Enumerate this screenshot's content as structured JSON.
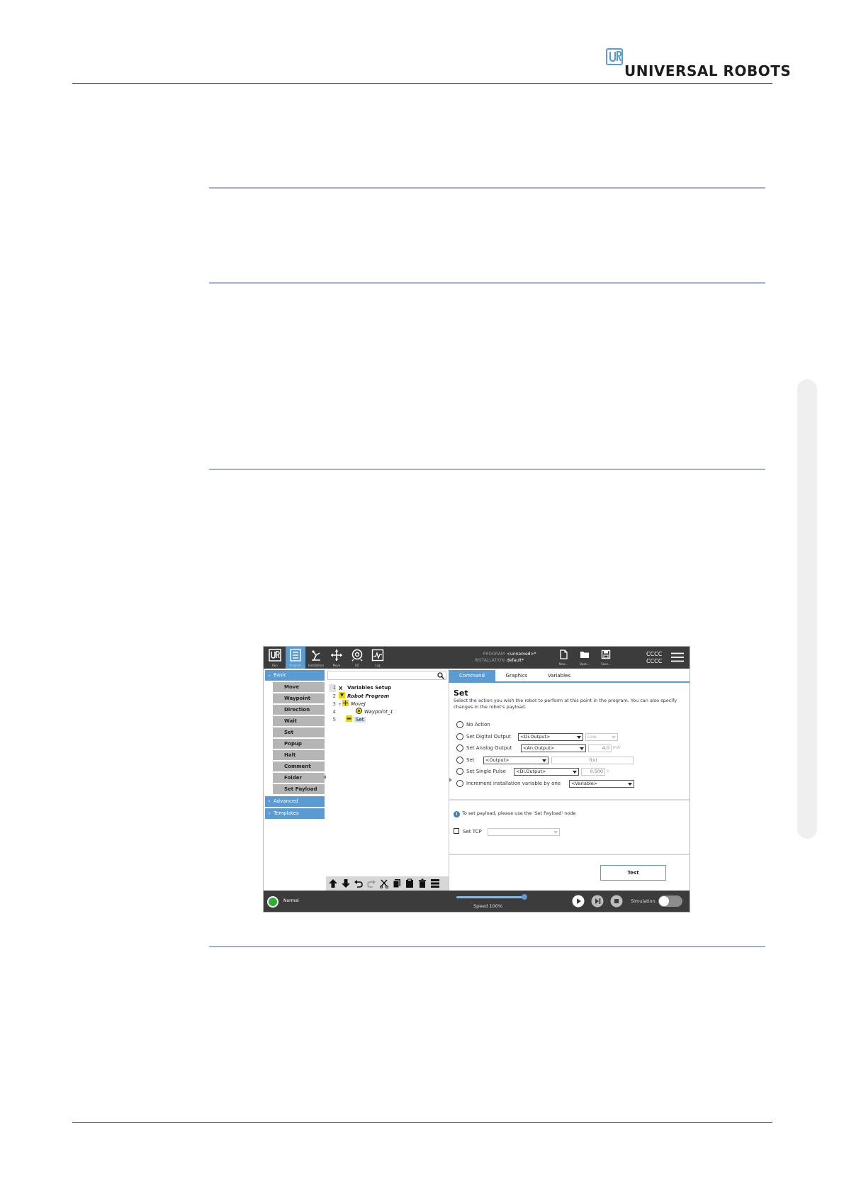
{
  "header": {
    "logo_text": "UNIVERSAL ROBOTS"
  },
  "screenshot": {
    "toolbar": {
      "buttons": [
        {
          "label": "Run",
          "icon": "ur-logo-icon"
        },
        {
          "label": "Program",
          "icon": "program-icon",
          "active": true
        },
        {
          "label": "Installation",
          "icon": "installation-icon"
        },
        {
          "label": "Move",
          "icon": "move-icon"
        },
        {
          "label": "I/O",
          "icon": "io-icon"
        },
        {
          "label": "Log",
          "icon": "log-icon"
        }
      ],
      "program_label": "PROGRAM",
      "program_value": "<unnamed>*",
      "installation_label": "INSTALLATION",
      "installation_value": "default*",
      "file_buttons": [
        {
          "label": "New...",
          "icon": "new-file-icon"
        },
        {
          "label": "Open...",
          "icon": "open-folder-icon"
        },
        {
          "label": "Save...",
          "icon": "save-icon"
        }
      ],
      "status_code_1": "CCCC",
      "status_code_2": "CCCC"
    },
    "palette": {
      "basic_label": "Basic",
      "basic_items": [
        "Move",
        "Waypoint",
        "Direction",
        "Wait",
        "Set",
        "Popup",
        "Halt",
        "Comment",
        "Folder",
        "Set Payload"
      ],
      "advanced_label": "Advanced",
      "templates_label": "Templates"
    },
    "tree": {
      "rows": [
        {
          "num": "1",
          "text": "Variables Setup",
          "icon": "variables-icon"
        },
        {
          "num": "2",
          "text": "Robot Program",
          "icon": "program-flag-icon"
        },
        {
          "num": "3",
          "text": "MoveJ",
          "icon": "movej-icon"
        },
        {
          "num": "4",
          "text": "Waypoint_1",
          "icon": "waypoint-icon"
        },
        {
          "num": "5",
          "text": "Set",
          "icon": "set-icon"
        }
      ]
    },
    "tabs": [
      "Command",
      "Graphics",
      "Variables"
    ],
    "command": {
      "title": "Set",
      "description": "Select the action you wish the robot to perform at this point in the program. You can also specify changes in the robot's payload.",
      "options": {
        "no_action": "No Action",
        "digital_output": "Set Digital Output",
        "digital_output_select": "<Di.Output>",
        "digital_value_select": "Low",
        "analog_output": "Set Analog Output",
        "analog_output_select": "<An.Output>",
        "analog_value": "4.0",
        "analog_unit": "mA",
        "set": "Set",
        "set_output_select": "<Output>",
        "set_expression": "f(x)",
        "single_pulse": "Set Single Pulse",
        "pulse_output_select": "<Di.Output>",
        "pulse_value": "0.500",
        "pulse_unit": "s",
        "increment": "Increment installation variable by one",
        "increment_select": "<Variable>"
      },
      "payload_info": "To set payload, please use the 'Set Payload' node",
      "set_tcp": "Set TCP",
      "test_label": "Test"
    },
    "bottom": {
      "status": "Normal",
      "speed": "Speed 100%",
      "speed_fraction": 1.0,
      "simulation": "Simulation"
    }
  }
}
